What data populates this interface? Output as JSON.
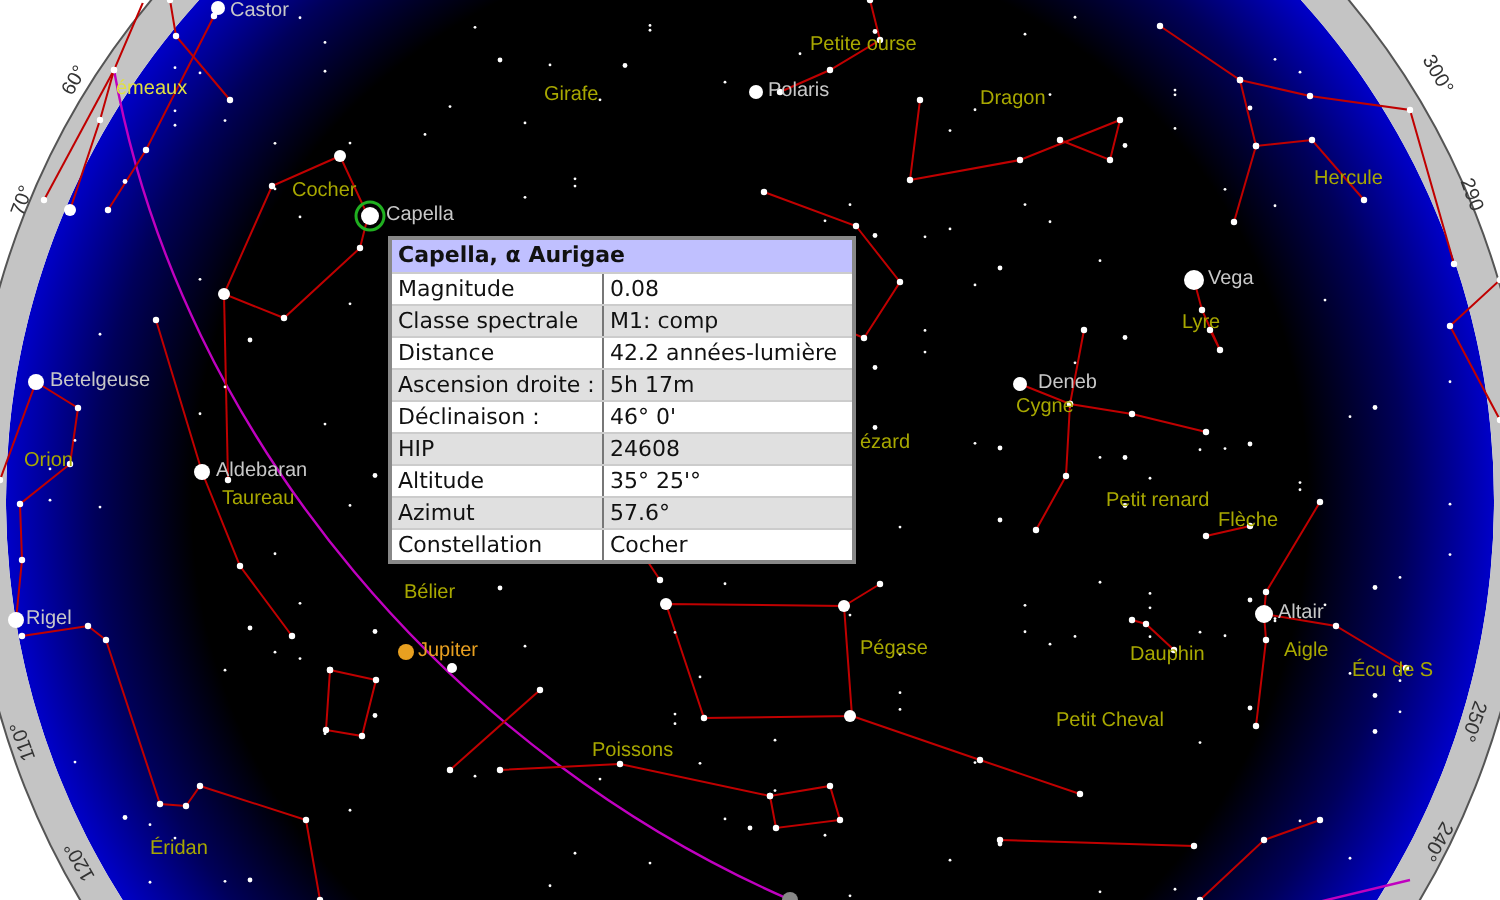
{
  "sky_map": {
    "star_labels": [
      "Castor",
      "Polaris",
      "Capella",
      "Vega",
      "Deneb",
      "Betelgeuse",
      "Aldebaran",
      "Rigel",
      "Altair"
    ],
    "constellation_labels": [
      "Petite ourse",
      "Girafe",
      "Dragon",
      "émeaux",
      "Hercule",
      "Cocher",
      "Lyre",
      "Cygne",
      "ézard",
      "Orion",
      "Taureau",
      "Petit renard",
      "Flèche",
      "Bélier",
      "Pégase",
      "Dauphin",
      "Aigle",
      "Écu de S",
      "Petit Cheval",
      "Poissons",
      "Éridan"
    ],
    "planets": [
      {
        "name": "Jupiter",
        "color": "#e8a020"
      }
    ],
    "degree_labels": [
      "60°",
      "70°",
      "110°",
      "120°",
      "300°",
      "290",
      "250°",
      "240°"
    ]
  },
  "info_popup": {
    "title": "Capella, α Aurigae",
    "rows": [
      {
        "label": "Magnitude",
        "value": "0.08"
      },
      {
        "label": "Classe spectrale",
        "value": "M1: comp"
      },
      {
        "label": "Distance",
        "value": "42.2 années-lumière"
      },
      {
        "label": "Ascension droite :",
        "value": "5h 17m"
      },
      {
        "label": "Déclinaison :",
        "value": "46° 0'"
      },
      {
        "label": "HIP",
        "value": "24608"
      },
      {
        "label": "Altitude",
        "value": "35° 25'°"
      },
      {
        "label": "Azimut",
        "value": "57.6°"
      },
      {
        "label": "Constellation",
        "value": "Cocher"
      }
    ]
  }
}
